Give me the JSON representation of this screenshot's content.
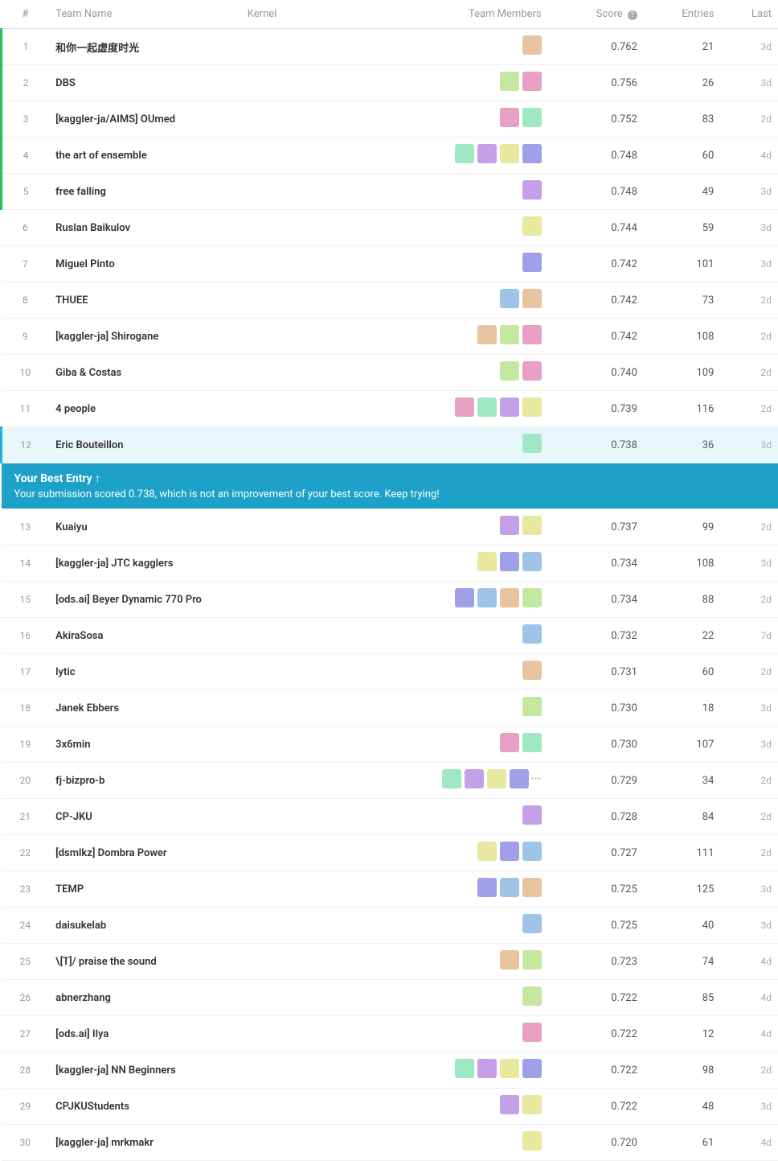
{
  "header": {
    "col_num": "#",
    "col_team": "Team Name",
    "col_kernel": "Kernel",
    "col_members": "Team Members",
    "col_score": "Score",
    "col_entries": "Entries",
    "col_last": "Last"
  },
  "banner": {
    "title": "Your Best Entry ↑",
    "message": "Your submission scored 0.738, which is not an improvement of your best score. Keep trying!"
  },
  "rows": [
    {
      "rank": 1,
      "team": "和你一起虚度时光",
      "score": "0.762",
      "entries": "21",
      "last": "3d",
      "highlight": false,
      "topRank": true,
      "avatarCount": 1
    },
    {
      "rank": 2,
      "team": "DBS",
      "score": "0.756",
      "entries": "26",
      "last": "3d",
      "highlight": false,
      "topRank": true,
      "avatarCount": 2
    },
    {
      "rank": 3,
      "team": "[kaggler-ja/AIMS] OUmed",
      "score": "0.752",
      "entries": "83",
      "last": "2d",
      "highlight": false,
      "topRank": true,
      "avatarCount": 2
    },
    {
      "rank": 4,
      "team": "the art of ensemble",
      "score": "0.748",
      "entries": "60",
      "last": "4d",
      "highlight": false,
      "topRank": true,
      "avatarCount": 4
    },
    {
      "rank": 5,
      "team": "free falling",
      "score": "0.748",
      "entries": "49",
      "last": "3d",
      "highlight": false,
      "topRank": true,
      "avatarCount": 1
    },
    {
      "rank": 6,
      "team": "Ruslan Baikulov",
      "score": "0.744",
      "entries": "59",
      "last": "3d",
      "highlight": false,
      "topRank": false,
      "avatarCount": 1
    },
    {
      "rank": 7,
      "team": "Miguel Pinto",
      "score": "0.742",
      "entries": "101",
      "last": "3d",
      "highlight": false,
      "topRank": false,
      "avatarCount": 1
    },
    {
      "rank": 8,
      "team": "THUEE",
      "score": "0.742",
      "entries": "73",
      "last": "2d",
      "highlight": false,
      "topRank": false,
      "avatarCount": 2
    },
    {
      "rank": 9,
      "team": "[kaggler-ja] Shirogane",
      "score": "0.742",
      "entries": "108",
      "last": "2d",
      "highlight": false,
      "topRank": false,
      "avatarCount": 3
    },
    {
      "rank": 10,
      "team": "Giba & Costas",
      "score": "0.740",
      "entries": "109",
      "last": "2d",
      "highlight": false,
      "topRank": false,
      "avatarCount": 2
    },
    {
      "rank": 11,
      "team": "4 people",
      "score": "0.739",
      "entries": "116",
      "last": "2d",
      "highlight": false,
      "topRank": false,
      "avatarCount": 4
    },
    {
      "rank": 12,
      "team": "Eric Bouteillon",
      "score": "0.738",
      "entries": "36",
      "last": "3d",
      "highlight": true,
      "topRank": false,
      "avatarCount": 1
    },
    {
      "rank": 13,
      "team": "Kuaiyu",
      "score": "0.737",
      "entries": "99",
      "last": "2d",
      "highlight": false,
      "topRank": false,
      "avatarCount": 2
    },
    {
      "rank": 14,
      "team": "[kaggler-ja] JTC kagglers",
      "score": "0.734",
      "entries": "108",
      "last": "3d",
      "highlight": false,
      "topRank": false,
      "avatarCount": 3
    },
    {
      "rank": 15,
      "team": "[ods.ai] Beyer Dynamic 770 Pro",
      "score": "0.734",
      "entries": "88",
      "last": "2d",
      "highlight": false,
      "topRank": false,
      "avatarCount": 4
    },
    {
      "rank": 16,
      "team": "AkiraSosa",
      "score": "0.732",
      "entries": "22",
      "last": "7d",
      "highlight": false,
      "topRank": false,
      "avatarCount": 1
    },
    {
      "rank": 17,
      "team": "lytic",
      "score": "0.731",
      "entries": "60",
      "last": "2d",
      "highlight": false,
      "topRank": false,
      "avatarCount": 1
    },
    {
      "rank": 18,
      "team": "Janek Ebbers",
      "score": "0.730",
      "entries": "18",
      "last": "3d",
      "highlight": false,
      "topRank": false,
      "avatarCount": 1
    },
    {
      "rank": 19,
      "team": "3x6min",
      "score": "0.730",
      "entries": "107",
      "last": "3d",
      "highlight": false,
      "topRank": false,
      "avatarCount": 2
    },
    {
      "rank": 20,
      "team": "fj-bizpro-b",
      "score": "0.729",
      "entries": "34",
      "last": "2d",
      "highlight": false,
      "topRank": false,
      "avatarCount": 5
    },
    {
      "rank": 21,
      "team": "CP-JKU",
      "score": "0.728",
      "entries": "84",
      "last": "2d",
      "highlight": false,
      "topRank": false,
      "avatarCount": 1
    },
    {
      "rank": 22,
      "team": "[dsmlkz] Dombra Power",
      "score": "0.727",
      "entries": "111",
      "last": "2d",
      "highlight": false,
      "topRank": false,
      "avatarCount": 3
    },
    {
      "rank": 23,
      "team": "TEMP",
      "score": "0.725",
      "entries": "125",
      "last": "3d",
      "highlight": false,
      "topRank": false,
      "avatarCount": 3
    },
    {
      "rank": 24,
      "team": "daisukelab",
      "score": "0.725",
      "entries": "40",
      "last": "3d",
      "highlight": false,
      "topRank": false,
      "avatarCount": 1
    },
    {
      "rank": 25,
      "team": "\\[T]/ praise the sound",
      "score": "0.723",
      "entries": "74",
      "last": "4d",
      "highlight": false,
      "topRank": false,
      "avatarCount": 2
    },
    {
      "rank": 26,
      "team": "abnerzhang",
      "score": "0.722",
      "entries": "85",
      "last": "4d",
      "highlight": false,
      "topRank": false,
      "avatarCount": 1
    },
    {
      "rank": 27,
      "team": "[ods.ai] Ilya",
      "score": "0.722",
      "entries": "12",
      "last": "4d",
      "highlight": false,
      "topRank": false,
      "avatarCount": 1
    },
    {
      "rank": 28,
      "team": "[kaggler-ja] NN Beginners",
      "score": "0.722",
      "entries": "98",
      "last": "2d",
      "highlight": false,
      "topRank": false,
      "avatarCount": 4
    },
    {
      "rank": 29,
      "team": "CPJKUStudents",
      "score": "0.722",
      "entries": "48",
      "last": "3d",
      "highlight": false,
      "topRank": false,
      "avatarCount": 2
    },
    {
      "rank": 30,
      "team": "[kaggler-ja] mrkmakr",
      "score": "0.720",
      "entries": "61",
      "last": "4d",
      "highlight": false,
      "topRank": false,
      "avatarCount": 1
    }
  ]
}
